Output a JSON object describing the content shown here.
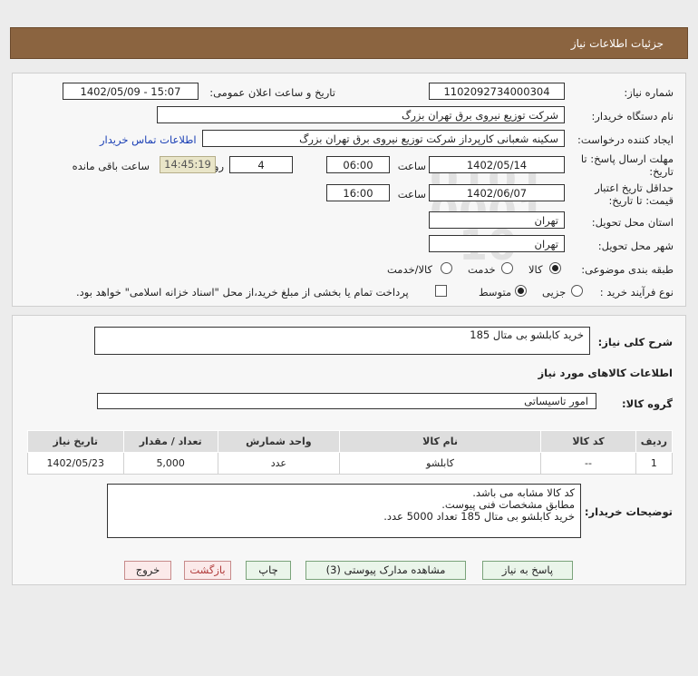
{
  "header": {
    "title": "جزئیات اطلاعات نیاز"
  },
  "form": {
    "need_number_label": "شماره نیاز:",
    "need_number": "1102092734000304",
    "announce_label": "تاریخ و ساعت اعلان عمومی:",
    "announce_value": "1402/05/09 - 15:07",
    "buyer_org_label": "نام دستگاه خریدار:",
    "buyer_org": "شرکت توزیع نیروی برق تهران بزرگ",
    "creator_label": "ایجاد کننده درخواست:",
    "creator": "سکینه شعبانی کارپرداز شرکت توزیع نیروی برق تهران بزرگ",
    "contact_link": "اطلاعات تماس خریدار",
    "deadline_label_1": "مهلت ارسال پاسخ: تا",
    "deadline_label_2": "تاریخ:",
    "deadline_date": "1402/05/14",
    "time_label": "ساعت",
    "deadline_time": "06:00",
    "days": "4",
    "days_label": "روز و",
    "remaining_time": "14:45:19",
    "remaining_label": "ساعت باقی مانده",
    "validity_label_1": "حداقل تاریخ اعتبار",
    "validity_label_2": "قیمت: تا تاریخ:",
    "validity_date": "1402/06/07",
    "validity_time": "16:00",
    "province_label": "استان محل تحویل:",
    "province": "تهران",
    "city_label": "شهر محل تحویل:",
    "city": "تهران",
    "category_label": "طبقه بندی موضوعی:",
    "category_options": [
      "کالا",
      "خدمت",
      "کالا/خدمت"
    ],
    "category_selected": "کالا",
    "process_label": "نوع فرآیند خرید :",
    "process_options": [
      "جزیی",
      "متوسط"
    ],
    "process_selected": "متوسط",
    "payment_note": "پرداخت تمام یا بخشی از مبلغ خرید،از محل \"اسناد خزانه اسلامی\" خواهد بود."
  },
  "summary": {
    "label": "شرح کلی نیاز:",
    "value": "خرید کابلشو بی متال 185"
  },
  "goods": {
    "section_title": "اطلاعات کالاهای مورد نیاز",
    "group_label": "گروه کالا:",
    "group_value": "امور تاسیساتی",
    "columns": [
      "ردیف",
      "کد کالا",
      "نام کالا",
      "واحد شمارش",
      "تعداد / مقدار",
      "تاریخ نیاز"
    ],
    "rows": [
      [
        "1",
        "--",
        "کابلشو",
        "عدد",
        "5,000",
        "1402/05/23"
      ]
    ]
  },
  "buyer_notes": {
    "label": "توضیحات خریدار:",
    "text": "کد کالا مشابه می باشد.\nمطابق مشخصات فنی پیوست.\nخرید کابلشو بی متال 185 تعداد 5000 عدد."
  },
  "buttons": {
    "reply": "پاسخ به نیاز",
    "attachments": "مشاهده مدارک پیوستی (3)",
    "print": "چاپ",
    "back": "بازگشت",
    "exit": "خروج"
  },
  "watermark": {
    "brand": "ParsNamadData",
    "line1": "مرکز فراوری اطلاعات پارس نماد داده",
    "line2": "پایگاه اطلاع رسانی مناقصات و مزایده",
    "phone": "۰۲۱-۸۸۳۴۹۶۷۰-۵",
    "number": "0101 0001 10"
  },
  "colors": {
    "header_bg": "#8b6440",
    "link": "#1a3fb5",
    "button_bg": "#eaf5ea"
  }
}
